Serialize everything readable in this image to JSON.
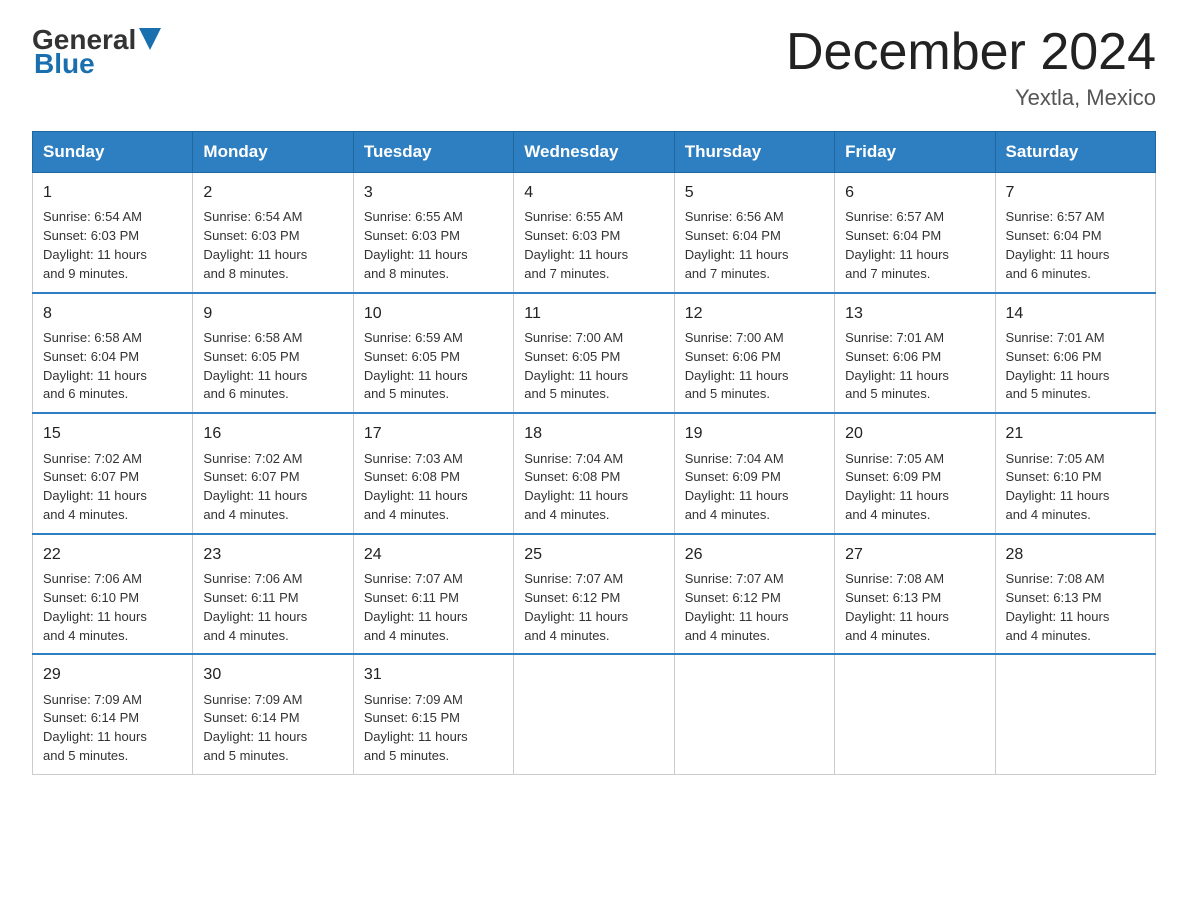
{
  "logo": {
    "general": "General",
    "blue": "Blue"
  },
  "title": "December 2024",
  "location": "Yextla, Mexico",
  "days": [
    "Sunday",
    "Monday",
    "Tuesday",
    "Wednesday",
    "Thursday",
    "Friday",
    "Saturday"
  ],
  "weeks": [
    [
      {
        "day": "1",
        "sunrise": "6:54 AM",
        "sunset": "6:03 PM",
        "daylight": "11 hours and 9 minutes."
      },
      {
        "day": "2",
        "sunrise": "6:54 AM",
        "sunset": "6:03 PM",
        "daylight": "11 hours and 8 minutes."
      },
      {
        "day": "3",
        "sunrise": "6:55 AM",
        "sunset": "6:03 PM",
        "daylight": "11 hours and 8 minutes."
      },
      {
        "day": "4",
        "sunrise": "6:55 AM",
        "sunset": "6:03 PM",
        "daylight": "11 hours and 7 minutes."
      },
      {
        "day": "5",
        "sunrise": "6:56 AM",
        "sunset": "6:04 PM",
        "daylight": "11 hours and 7 minutes."
      },
      {
        "day": "6",
        "sunrise": "6:57 AM",
        "sunset": "6:04 PM",
        "daylight": "11 hours and 7 minutes."
      },
      {
        "day": "7",
        "sunrise": "6:57 AM",
        "sunset": "6:04 PM",
        "daylight": "11 hours and 6 minutes."
      }
    ],
    [
      {
        "day": "8",
        "sunrise": "6:58 AM",
        "sunset": "6:04 PM",
        "daylight": "11 hours and 6 minutes."
      },
      {
        "day": "9",
        "sunrise": "6:58 AM",
        "sunset": "6:05 PM",
        "daylight": "11 hours and 6 minutes."
      },
      {
        "day": "10",
        "sunrise": "6:59 AM",
        "sunset": "6:05 PM",
        "daylight": "11 hours and 5 minutes."
      },
      {
        "day": "11",
        "sunrise": "7:00 AM",
        "sunset": "6:05 PM",
        "daylight": "11 hours and 5 minutes."
      },
      {
        "day": "12",
        "sunrise": "7:00 AM",
        "sunset": "6:06 PM",
        "daylight": "11 hours and 5 minutes."
      },
      {
        "day": "13",
        "sunrise": "7:01 AM",
        "sunset": "6:06 PM",
        "daylight": "11 hours and 5 minutes."
      },
      {
        "day": "14",
        "sunrise": "7:01 AM",
        "sunset": "6:06 PM",
        "daylight": "11 hours and 5 minutes."
      }
    ],
    [
      {
        "day": "15",
        "sunrise": "7:02 AM",
        "sunset": "6:07 PM",
        "daylight": "11 hours and 4 minutes."
      },
      {
        "day": "16",
        "sunrise": "7:02 AM",
        "sunset": "6:07 PM",
        "daylight": "11 hours and 4 minutes."
      },
      {
        "day": "17",
        "sunrise": "7:03 AM",
        "sunset": "6:08 PM",
        "daylight": "11 hours and 4 minutes."
      },
      {
        "day": "18",
        "sunrise": "7:04 AM",
        "sunset": "6:08 PM",
        "daylight": "11 hours and 4 minutes."
      },
      {
        "day": "19",
        "sunrise": "7:04 AM",
        "sunset": "6:09 PM",
        "daylight": "11 hours and 4 minutes."
      },
      {
        "day": "20",
        "sunrise": "7:05 AM",
        "sunset": "6:09 PM",
        "daylight": "11 hours and 4 minutes."
      },
      {
        "day": "21",
        "sunrise": "7:05 AM",
        "sunset": "6:10 PM",
        "daylight": "11 hours and 4 minutes."
      }
    ],
    [
      {
        "day": "22",
        "sunrise": "7:06 AM",
        "sunset": "6:10 PM",
        "daylight": "11 hours and 4 minutes."
      },
      {
        "day": "23",
        "sunrise": "7:06 AM",
        "sunset": "6:11 PM",
        "daylight": "11 hours and 4 minutes."
      },
      {
        "day": "24",
        "sunrise": "7:07 AM",
        "sunset": "6:11 PM",
        "daylight": "11 hours and 4 minutes."
      },
      {
        "day": "25",
        "sunrise": "7:07 AM",
        "sunset": "6:12 PM",
        "daylight": "11 hours and 4 minutes."
      },
      {
        "day": "26",
        "sunrise": "7:07 AM",
        "sunset": "6:12 PM",
        "daylight": "11 hours and 4 minutes."
      },
      {
        "day": "27",
        "sunrise": "7:08 AM",
        "sunset": "6:13 PM",
        "daylight": "11 hours and 4 minutes."
      },
      {
        "day": "28",
        "sunrise": "7:08 AM",
        "sunset": "6:13 PM",
        "daylight": "11 hours and 4 minutes."
      }
    ],
    [
      {
        "day": "29",
        "sunrise": "7:09 AM",
        "sunset": "6:14 PM",
        "daylight": "11 hours and 5 minutes."
      },
      {
        "day": "30",
        "sunrise": "7:09 AM",
        "sunset": "6:14 PM",
        "daylight": "11 hours and 5 minutes."
      },
      {
        "day": "31",
        "sunrise": "7:09 AM",
        "sunset": "6:15 PM",
        "daylight": "11 hours and 5 minutes."
      },
      null,
      null,
      null,
      null
    ]
  ],
  "labels": {
    "sunrise": "Sunrise:",
    "sunset": "Sunset:",
    "daylight": "Daylight:"
  }
}
